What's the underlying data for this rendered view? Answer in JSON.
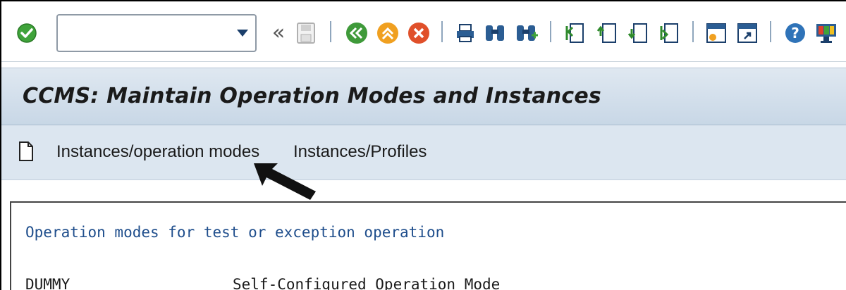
{
  "toolbar": {
    "command_field_value": "",
    "icons": [
      "enter-icon",
      "collapse-icon",
      "save-icon",
      "back-icon",
      "exit-icon",
      "cancel-icon",
      "print-icon",
      "find-icon",
      "find-next-icon",
      "first-page-icon",
      "previous-page-icon",
      "next-page-icon",
      "last-page-icon",
      "create-session-icon",
      "shortcut-icon",
      "help-icon",
      "customize-layout-icon"
    ],
    "colors": {
      "enter": "#3fa33a",
      "back": "#3f9a3a",
      "exit": "#f0a020",
      "cancel": "#e0502a",
      "help": "#2f73b8"
    }
  },
  "title": "CCMS: Maintain Operation Modes and Instances",
  "app_toolbar": {
    "link_instances_operation_modes": "Instances/operation modes",
    "link_instances_profiles": "Instances/Profiles"
  },
  "content": {
    "section_title": "Operation modes for test or exception operation",
    "rows": [
      {
        "mode": "DUMMY",
        "description": "Self-Configured Operation Mode"
      }
    ]
  }
}
